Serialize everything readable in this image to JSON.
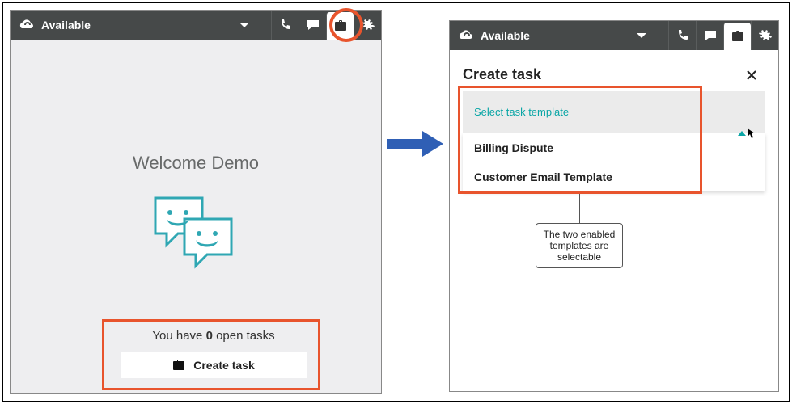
{
  "left": {
    "status_label": "Available",
    "welcome": "Welcome Demo",
    "open_tasks_prefix": "You have ",
    "open_tasks_count": "0",
    "open_tasks_suffix": " open tasks",
    "create_task_btn": "Create task"
  },
  "right": {
    "status_label": "Available",
    "panel_title": "Create task",
    "dropdown_placeholder": "Select task template",
    "options": [
      "Billing Dispute",
      "Customer Email Template"
    ]
  },
  "callout": {
    "line1": "The two enabled",
    "line2": "templates are",
    "line3": "selectable"
  },
  "colors": {
    "highlight": "#e8542d",
    "header": "#464949",
    "teal": "#2fa7b3",
    "arrow": "#2f5fb5"
  }
}
